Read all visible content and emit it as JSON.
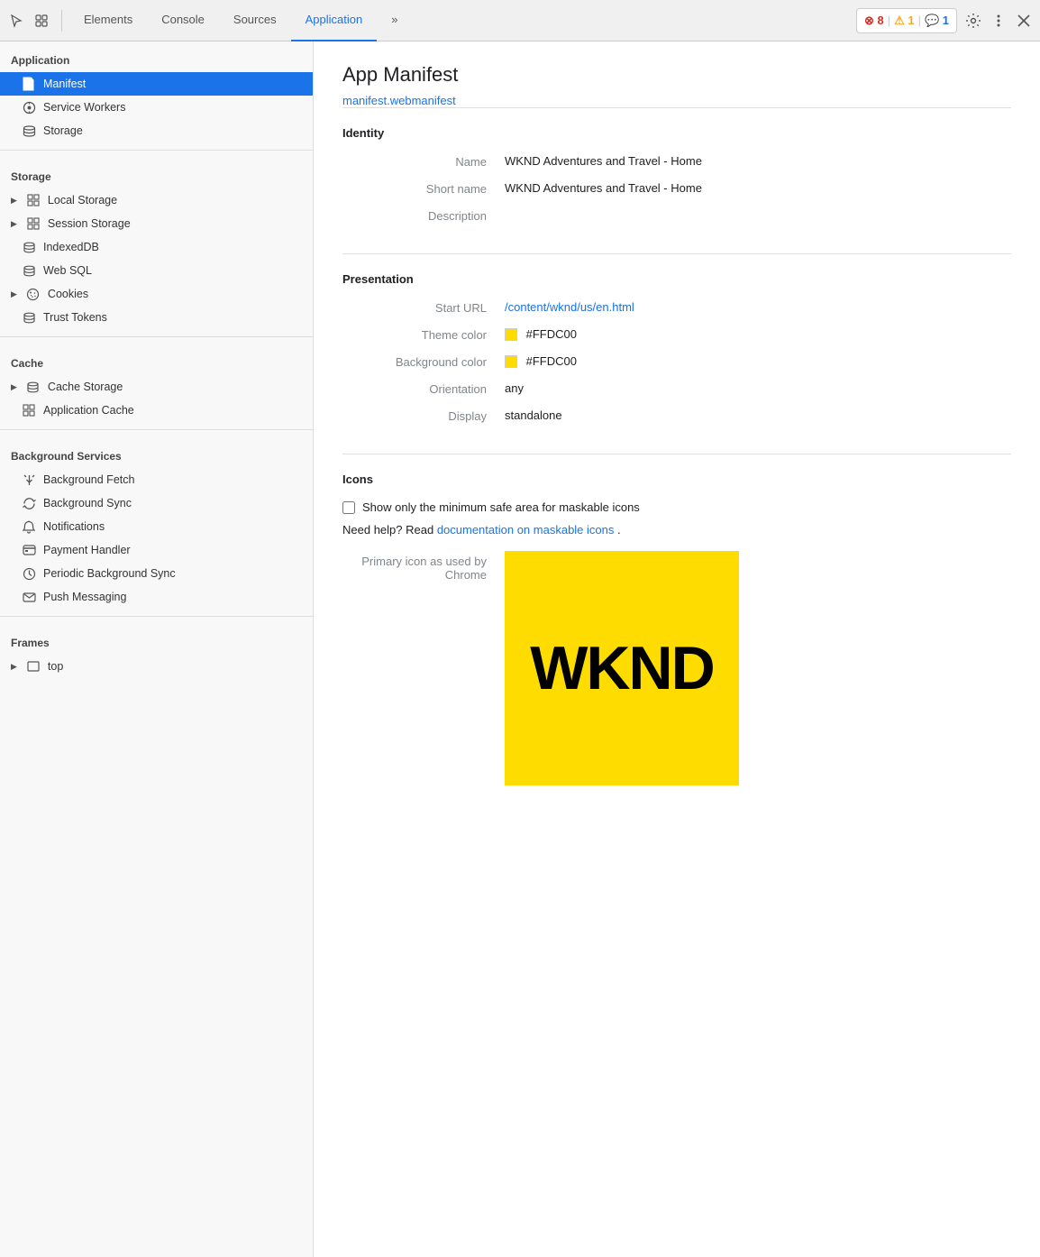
{
  "toolbar": {
    "tabs": [
      {
        "id": "elements",
        "label": "Elements",
        "active": false
      },
      {
        "id": "console",
        "label": "Console",
        "active": false
      },
      {
        "id": "sources",
        "label": "Sources",
        "active": false
      },
      {
        "id": "application",
        "label": "Application",
        "active": true
      },
      {
        "id": "more",
        "label": "»",
        "active": false
      }
    ],
    "badges": {
      "errors": "⊗ 8",
      "warnings": "⚠ 1",
      "info": "💬 1"
    }
  },
  "sidebar": {
    "application_section": "Application",
    "items_application": [
      {
        "id": "manifest",
        "label": "Manifest",
        "active": true
      },
      {
        "id": "service-workers",
        "label": "Service Workers",
        "active": false
      },
      {
        "id": "storage",
        "label": "Storage",
        "active": false
      }
    ],
    "storage_section": "Storage",
    "items_storage": [
      {
        "id": "local-storage",
        "label": "Local Storage",
        "hasArrow": true,
        "hasGridIcon": true
      },
      {
        "id": "session-storage",
        "label": "Session Storage",
        "hasArrow": true,
        "hasGridIcon": true
      },
      {
        "id": "indexeddb",
        "label": "IndexedDB",
        "hasArrow": false,
        "hasDBIcon": true
      },
      {
        "id": "web-sql",
        "label": "Web SQL",
        "hasArrow": false,
        "hasDBIcon": true
      },
      {
        "id": "cookies",
        "label": "Cookies",
        "hasArrow": true,
        "hasCookieIcon": true
      },
      {
        "id": "trust-tokens",
        "label": "Trust Tokens",
        "hasArrow": false,
        "hasDBIcon": true
      }
    ],
    "cache_section": "Cache",
    "items_cache": [
      {
        "id": "cache-storage",
        "label": "Cache Storage",
        "hasArrow": true,
        "hasDBIcon": true
      },
      {
        "id": "application-cache",
        "label": "Application Cache",
        "hasArrow": false,
        "hasGridIcon": true
      }
    ],
    "background_section": "Background Services",
    "items_background": [
      {
        "id": "bg-fetch",
        "label": "Background Fetch"
      },
      {
        "id": "bg-sync",
        "label": "Background Sync"
      },
      {
        "id": "notifications",
        "label": "Notifications"
      },
      {
        "id": "payment-handler",
        "label": "Payment Handler"
      },
      {
        "id": "periodic-bg-sync",
        "label": "Periodic Background Sync"
      },
      {
        "id": "push-messaging",
        "label": "Push Messaging"
      }
    ],
    "frames_section": "Frames",
    "items_frames": [
      {
        "id": "top",
        "label": "top",
        "hasArrow": true
      }
    ]
  },
  "content": {
    "title": "App Manifest",
    "manifest_link": "manifest.webmanifest",
    "identity": {
      "section_title": "Identity",
      "fields": [
        {
          "label": "Name",
          "value": "WKND Adventures and Travel - Home"
        },
        {
          "label": "Short name",
          "value": "WKND Adventures and Travel - Home"
        },
        {
          "label": "Description",
          "value": ""
        }
      ]
    },
    "presentation": {
      "section_title": "Presentation",
      "fields": [
        {
          "label": "Start URL",
          "value": "/content/wknd/us/en.html",
          "isLink": true
        },
        {
          "label": "Theme color",
          "value": "#FFDC00",
          "hasColor": true
        },
        {
          "label": "Background color",
          "value": "#FFDC00",
          "hasColor": true
        },
        {
          "label": "Orientation",
          "value": "any"
        },
        {
          "label": "Display",
          "value": "standalone"
        }
      ]
    },
    "icons": {
      "section_title": "Icons",
      "checkbox_label": "Show only the minimum safe area for maskable icons",
      "help_text": "Need help? Read ",
      "help_link": "documentation on maskable icons",
      "help_suffix": ".",
      "primary_label": "Primary icon as used by",
      "chrome_label": "Chrome",
      "wknd_text": "WKND",
      "icon_bg_color": "#FFDC00"
    }
  }
}
